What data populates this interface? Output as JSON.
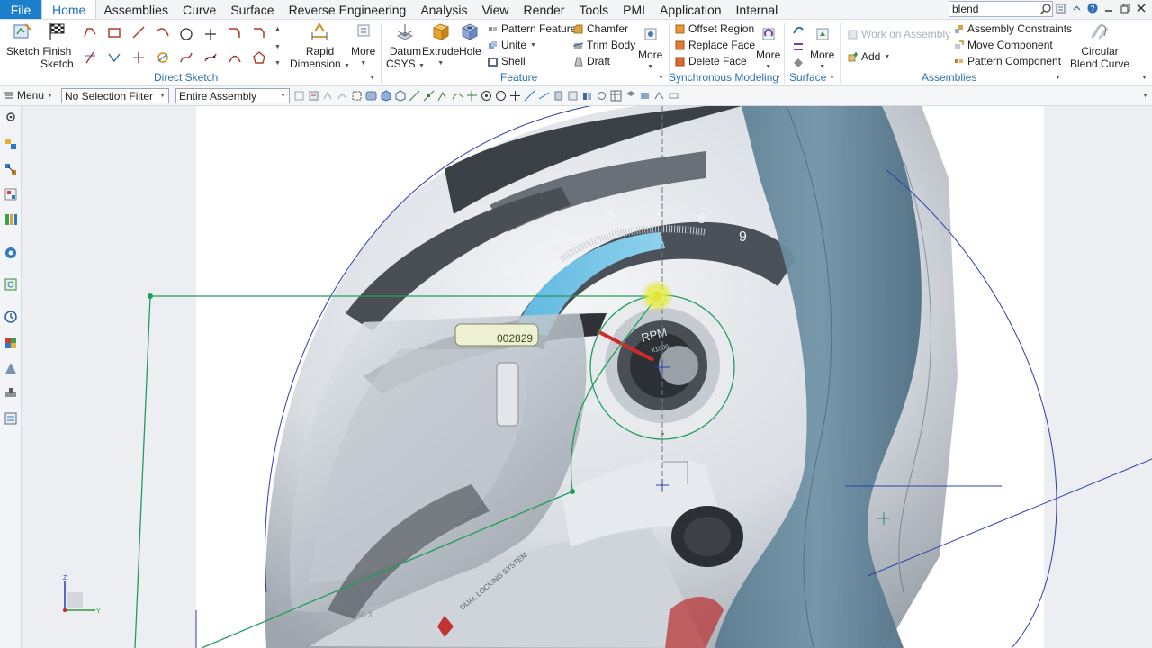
{
  "menu": {
    "file": "File",
    "tabs": [
      "Home",
      "Assemblies",
      "Curve",
      "Surface",
      "Reverse Engineering",
      "Analysis",
      "View",
      "Render",
      "Tools",
      "PMI",
      "Application",
      "Internal"
    ],
    "active_tab": "Home",
    "search_value": "blend"
  },
  "ribbon": {
    "sketch": "Sketch",
    "finish_sketch_1": "Finish",
    "finish_sketch_2": "Sketch",
    "rapid_dimension_1": "Rapid",
    "rapid_dimension_2": "Dimension",
    "more": "More",
    "datum_csys_1": "Datum",
    "datum_csys_2": "CSYS",
    "extrude": "Extrude",
    "hole": "Hole",
    "pattern_feature": "Pattern Feature",
    "unite": "Unite",
    "shell": "Shell",
    "chamfer": "Chamfer",
    "trim_body": "Trim Body",
    "draft": "Draft",
    "offset_region": "Offset Region",
    "replace_face": "Replace Face",
    "delete_face": "Delete Face",
    "work_on_assembly": "Work on Assembly",
    "add": "Add",
    "assembly_constraints": "Assembly Constraints",
    "move_component": "Move Component",
    "pattern_component": "Pattern Component",
    "circular_blend_1": "Circular",
    "circular_blend_2": "Blend Curve",
    "groups": {
      "direct_sketch": "Direct Sketch",
      "feature": "Feature",
      "synchronous_modeling": "Synchronous Modeling",
      "surface": "Surface",
      "assemblies": "Assemblies"
    }
  },
  "selection_bar": {
    "menu": "Menu",
    "filter": "No Selection Filter",
    "scope": "Entire Assembly"
  },
  "viewport": {
    "gauge_numbers": [
      "4",
      "5",
      "6",
      "7",
      "8",
      "9"
    ],
    "gauge_brand": "RPM",
    "gauge_unit": "X1000",
    "sticker_code": "002829",
    "side_text": "DUAL LOCKING SYSTEM",
    "dimension_value": "56.3",
    "triad": {
      "z": "Z",
      "y": "Y"
    }
  },
  "colors": {
    "accent": "#1c7fcc",
    "sketch_green": "#1e9e5a",
    "curve_blue": "#2a3fb0",
    "surface_steel": "#5f7f93"
  }
}
